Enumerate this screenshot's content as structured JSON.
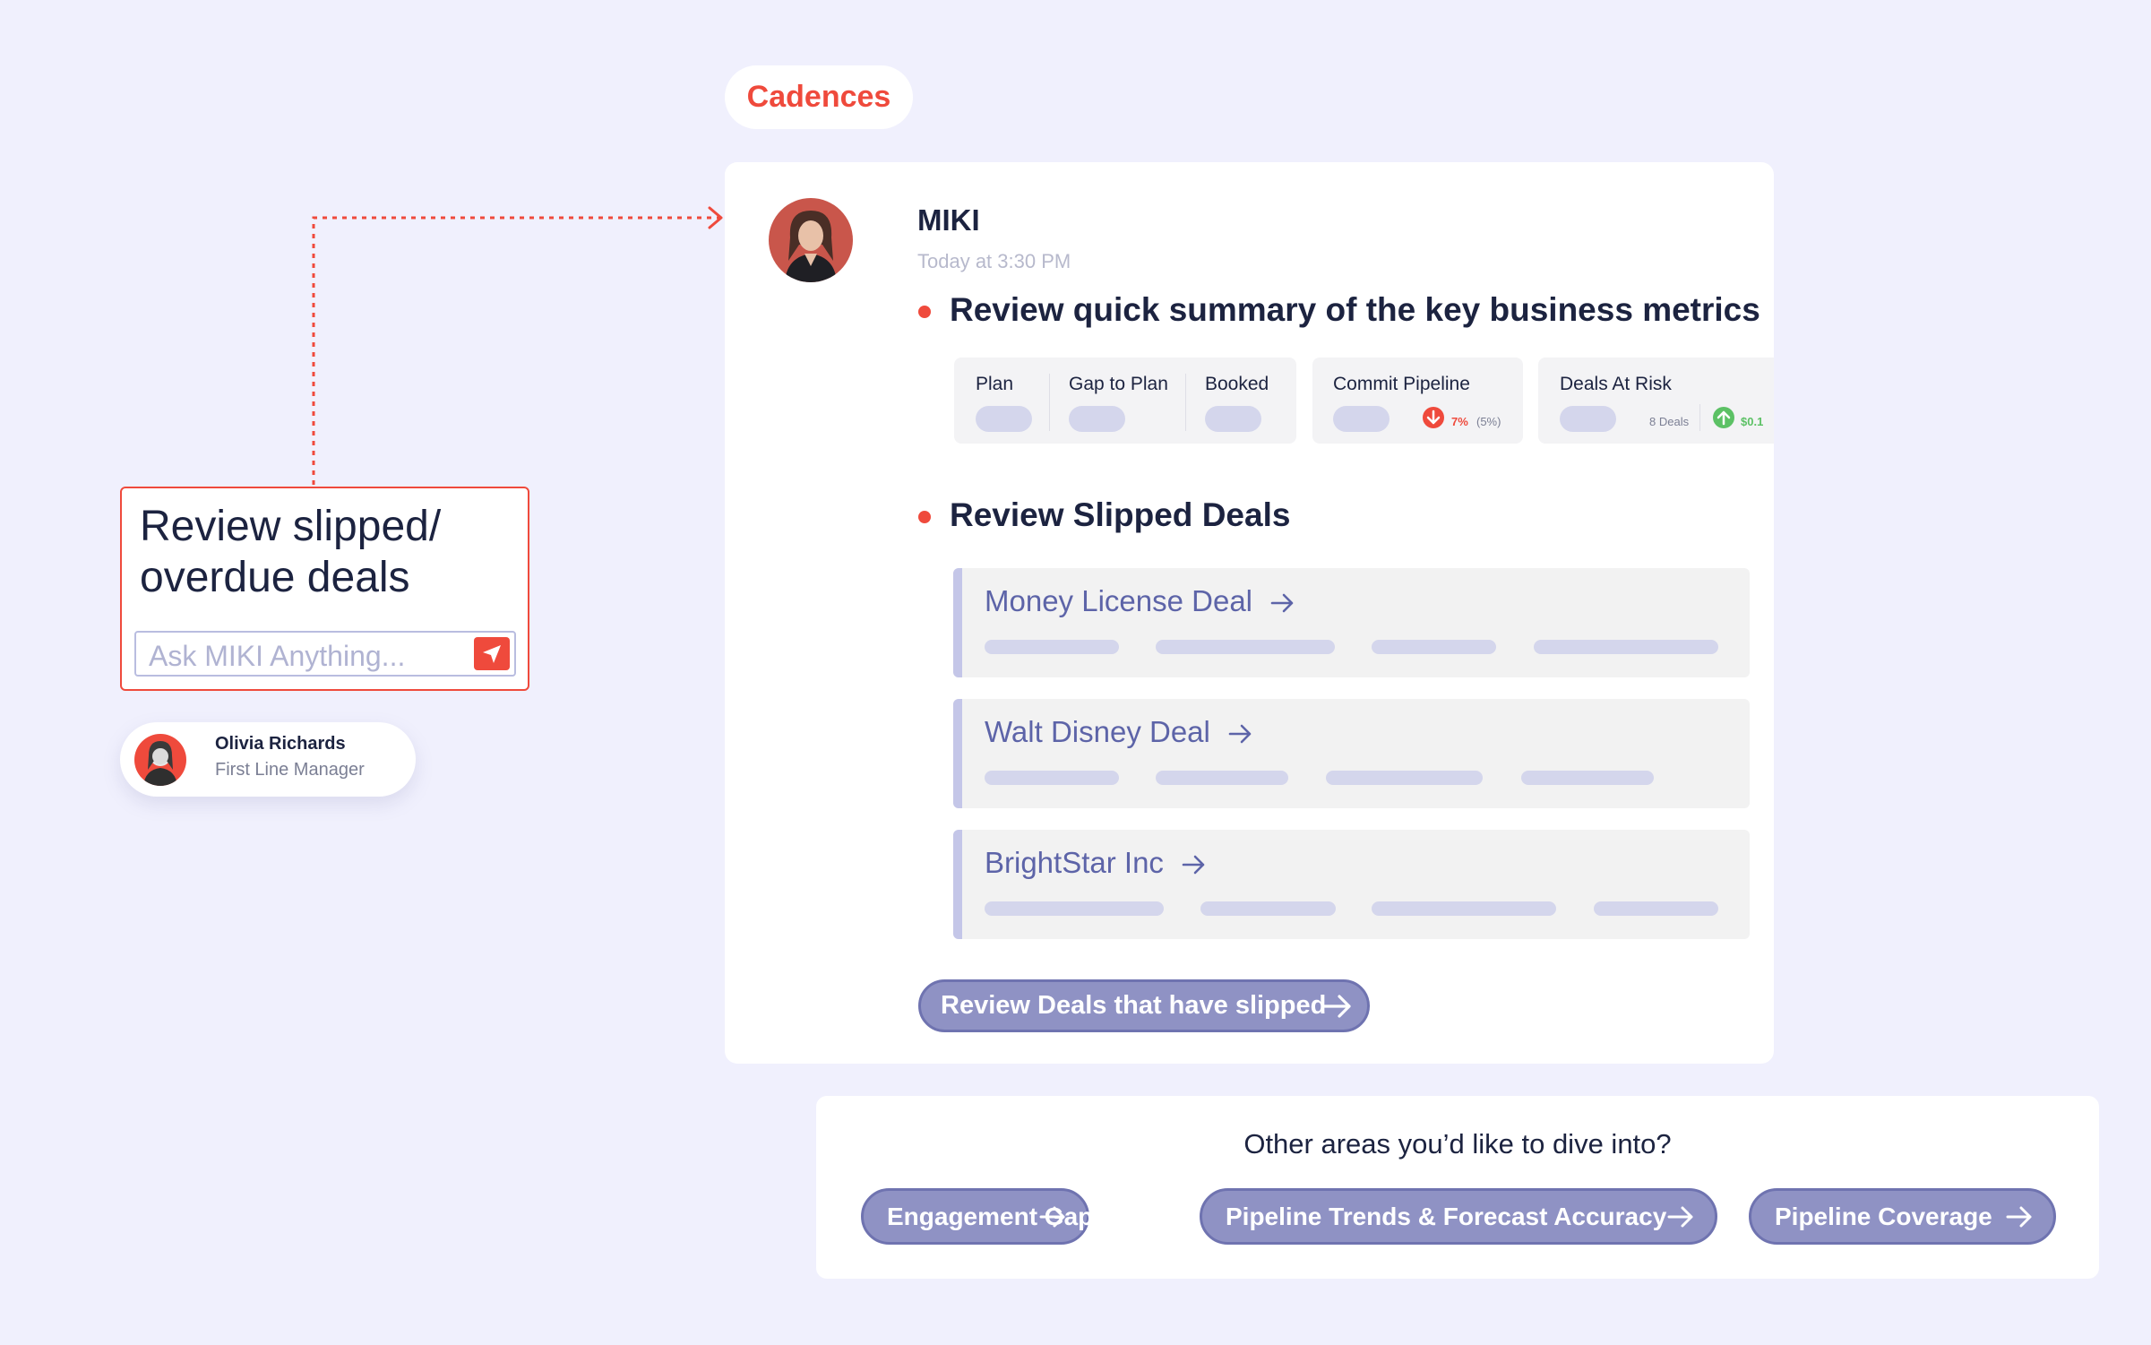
{
  "cadences": {
    "label": "Cadences"
  },
  "prompt": {
    "text": "Review slipped/ overdue deals",
    "input_placeholder": "Ask MIKI Anything..."
  },
  "user": {
    "name": "Olivia Richards",
    "role": "First Line Manager"
  },
  "message": {
    "sender": "MIKI",
    "time": "Today at 3:30 PM",
    "section1_title": "Review quick summary of the key business metrics",
    "metrics": {
      "plan": "Plan",
      "gap_to_plan": "Gap to Plan",
      "booked": "Booked",
      "commit_pipeline": "Commit Pipeline",
      "commit_change": "7%",
      "commit_change_pct": "(5%)",
      "deals_at_risk": "Deals At Risk",
      "risk_deals": "8 Deals",
      "risk_amount": "$0.1"
    },
    "section2_title": "Review Slipped Deals",
    "deals": [
      {
        "name": "Money License Deal"
      },
      {
        "name": "Walt Disney Deal"
      },
      {
        "name": "BrightStar Inc"
      }
    ],
    "review_button": "Review Deals that have slipped"
  },
  "other_areas": {
    "title": "Other areas you’d like to dive into?",
    "buttons": [
      {
        "label": "Engagement Gaps"
      },
      {
        "label": "Pipeline Trends & Forecast Accuracy"
      },
      {
        "label": "Pipeline Coverage"
      }
    ]
  },
  "colors": {
    "accent_red": "#ef4a3c",
    "purple_button": "#8f92c4",
    "deal_text": "#5d64a8",
    "background": "#f0f0fd"
  }
}
